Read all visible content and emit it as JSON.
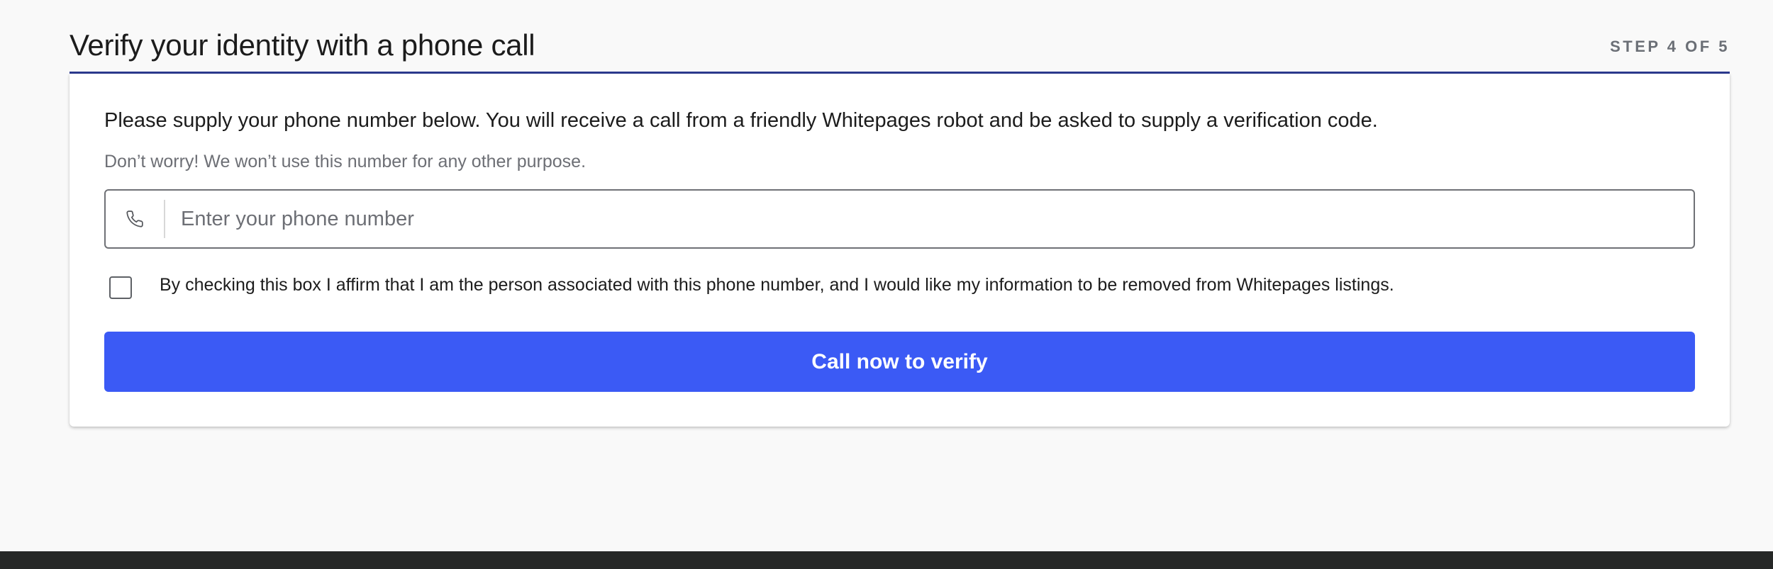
{
  "header": {
    "title": "Verify your identity with a phone call",
    "step": "STEP 4 OF 5"
  },
  "card": {
    "instructions": "Please supply your phone number below. You will receive a call from a friendly Whitepages robot and be asked to supply a verification code.",
    "reassurance": "Don’t worry! We won’t use this number for any other purpose.",
    "phone_field": {
      "icon": "phone-icon",
      "placeholder": "Enter your phone number",
      "value": ""
    },
    "consent": {
      "checked": false,
      "label": "By checking this box I affirm that I am the person associated with this phone number, and I would like my information to be removed from Whitepages listings."
    },
    "submit_label": "Call now to verify"
  },
  "colors": {
    "accent": "#3b5af5",
    "header_rule": "#2c3a8f",
    "muted_text": "#6d6f75",
    "footer": "#262827"
  }
}
